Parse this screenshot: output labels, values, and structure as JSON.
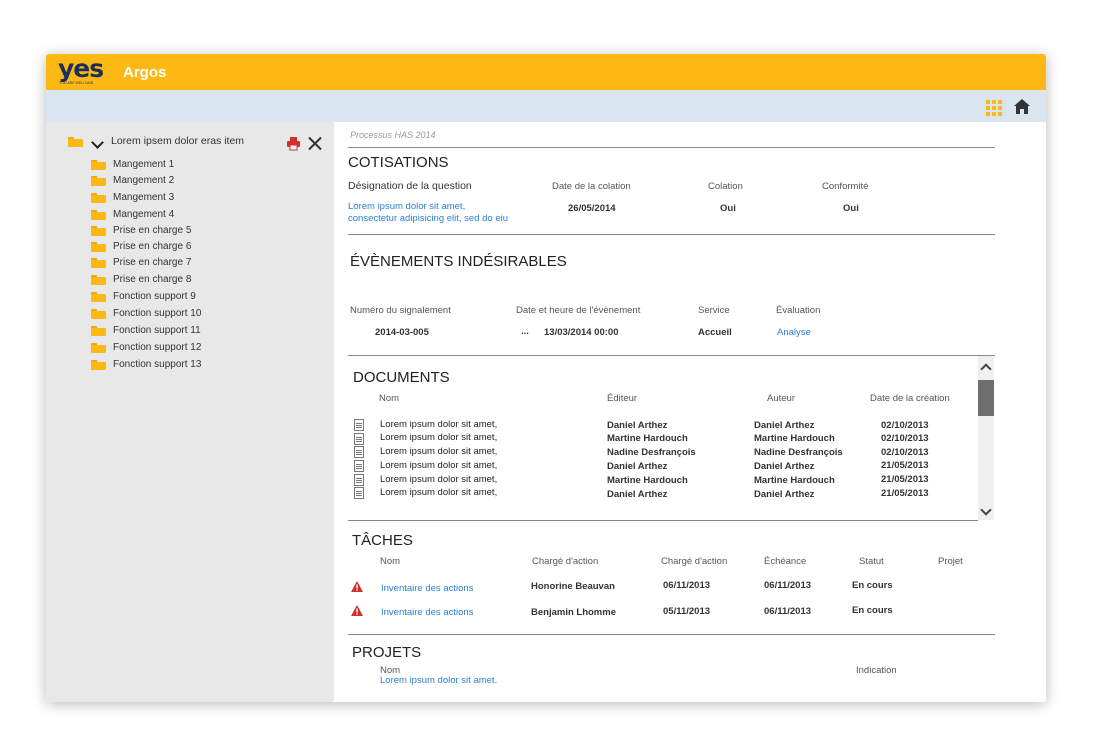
{
  "app": {
    "logo": "yes",
    "logo_tagline": "YOU ARE WELLSAID",
    "title": "Argos"
  },
  "colors": {
    "brand_yellow": "#FDB813",
    "subbar": "#d9e6f0",
    "sidebar": "#e8e8e8",
    "link": "#2a7fd6",
    "warning": "#d32f2f"
  },
  "sidebar": {
    "root_label": "Lorem ipsem dolor eras item",
    "items": [
      {
        "label": "Mangement 1"
      },
      {
        "label": "Mangement 2"
      },
      {
        "label": "Mangement 3"
      },
      {
        "label": "Mangement 4"
      },
      {
        "label": "Prise en charge 5"
      },
      {
        "label": "Prise en charge 6"
      },
      {
        "label": "Prise en charge 7"
      },
      {
        "label": "Prise en charge 8"
      },
      {
        "label": "Fonction support 9"
      },
      {
        "label": "Fonction support 10"
      },
      {
        "label": "Fonction support 11"
      },
      {
        "label": "Fonction support 12"
      },
      {
        "label": "Fonction support 13"
      }
    ]
  },
  "main": {
    "process": "Processus HAS 2014",
    "cotisations": {
      "title": "COTISATIONS",
      "headers": [
        "Désignation de la question",
        "Date de la colation",
        "Colation",
        "Conformité"
      ],
      "question_line1": "Lorem ipsum dolor sit amet,",
      "question_line2": "consectetur adipisicing elit, sed do eiu",
      "date": "26/05/2014",
      "colation": "Oui",
      "conformite": "Oui"
    },
    "evenements": {
      "title": "ÉVÈNEMENTS INDÉSIRABLES",
      "headers": [
        "Numéro du signalement",
        "Date et heure de l'évènement",
        "Service",
        "Évaluation"
      ],
      "numero": "2014-03-005",
      "ellipsis": "...",
      "datetime": "13/03/2014 00:00",
      "service": "Accueil",
      "evaluation": "Analyse"
    },
    "documents": {
      "title": "DOCUMENTS",
      "headers": [
        "Nom",
        "Éditeur",
        "Auteur",
        "Date de la création"
      ],
      "rows": [
        {
          "nom": "Lorem ipsum dolor sit amet,",
          "editeur": "Daniel Arthez",
          "auteur": "Daniel Arthez",
          "date": "02/10/2013"
        },
        {
          "nom": "Lorem ipsum dolor sit amet,",
          "editeur": "Martine Hardouch",
          "auteur": "Martine Hardouch",
          "date": "02/10/2013"
        },
        {
          "nom": "Lorem ipsum dolor sit amet,",
          "editeur": "Nadine Desfrançois",
          "auteur": "Nadine Desfrançois",
          "date": "02/10/2013"
        },
        {
          "nom": "Lorem ipsum dolor sit amet,",
          "editeur": "Daniel Arthez",
          "auteur": "Daniel Arthez",
          "date": "21/05/2013"
        },
        {
          "nom": "Lorem ipsum dolor sit amet,",
          "editeur": "Martine Hardouch",
          "auteur": "Martine Hardouch",
          "date": "21/05/2013"
        },
        {
          "nom": "Lorem ipsum dolor sit amet,",
          "editeur": "Daniel Arthez",
          "auteur": "Daniel Arthez",
          "date": "21/05/2013"
        }
      ]
    },
    "taches": {
      "title": "TÂCHES",
      "headers": [
        "Nom",
        "Chargé d'action",
        "Chargé d'action",
        "Échéance",
        "Statut",
        "Projet"
      ],
      "rows": [
        {
          "nom": "Inventaire des actions",
          "charge": "Honorine Beauvan",
          "date1": "06/11/2013",
          "echeance": "06/11/2013",
          "statut": "En cours"
        },
        {
          "nom": "Inventaire des actions",
          "charge": "Benjamin Lhomme",
          "date1": "05/11/2013",
          "echeance": "06/11/2013",
          "statut": "En cours"
        }
      ]
    },
    "projets": {
      "title": "PROJETS",
      "headers": [
        "Nom",
        "Indication"
      ],
      "rows": [
        {
          "nom": "Lorem ipsum dolor sit amet."
        }
      ]
    }
  }
}
